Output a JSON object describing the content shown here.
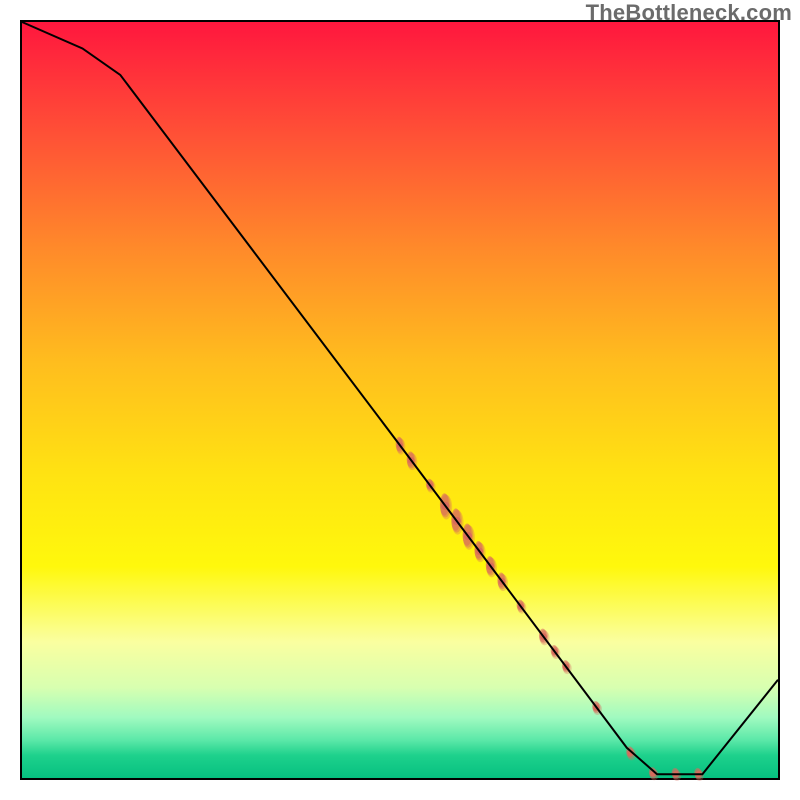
{
  "watermark": "TheBottleneck.com",
  "chart_data": {
    "type": "line",
    "title": "",
    "xlabel": "",
    "ylabel": "",
    "xlim": [
      0,
      100
    ],
    "ylim": [
      0,
      100
    ],
    "curve": {
      "x": [
        0,
        8,
        13,
        50,
        80,
        84,
        90,
        100
      ],
      "y": [
        100,
        96.5,
        93,
        44,
        4,
        0.5,
        0.5,
        13
      ]
    },
    "scatter_clusters": [
      {
        "cx": 50.0,
        "cy": 44.0,
        "r": 3.8,
        "cluster_height": 2.0
      },
      {
        "cx": 51.5,
        "cy": 42.0,
        "r": 4.2,
        "cluster_height": 2.0
      },
      {
        "cx": 54.0,
        "cy": 38.7,
        "r": 3.8,
        "cluster_height": 1.0
      },
      {
        "cx": 56.0,
        "cy": 36.0,
        "r": 5.0,
        "cluster_height": 3.5
      },
      {
        "cx": 57.5,
        "cy": 34.0,
        "r": 5.0,
        "cluster_height": 3.5
      },
      {
        "cx": 59.0,
        "cy": 32.0,
        "r": 5.0,
        "cluster_height": 3.5
      },
      {
        "cx": 60.5,
        "cy": 30.0,
        "r": 4.5,
        "cluster_height": 2.5
      },
      {
        "cx": 62.0,
        "cy": 28.0,
        "r": 4.5,
        "cluster_height": 2.5
      },
      {
        "cx": 63.5,
        "cy": 26.0,
        "r": 4.2,
        "cluster_height": 2.0
      },
      {
        "cx": 66.0,
        "cy": 22.7,
        "r": 3.8,
        "cluster_height": 1.0
      },
      {
        "cx": 69.0,
        "cy": 18.7,
        "r": 4.2,
        "cluster_height": 1.5
      },
      {
        "cx": 70.5,
        "cy": 16.7,
        "r": 3.8,
        "cluster_height": 1.0
      },
      {
        "cx": 72.0,
        "cy": 14.7,
        "r": 3.8,
        "cluster_height": 1.0
      },
      {
        "cx": 76.0,
        "cy": 9.3,
        "r": 3.8,
        "cluster_height": 1.0
      },
      {
        "cx": 80.5,
        "cy": 3.3,
        "r": 3.8,
        "cluster_height": 1.0
      },
      {
        "cx": 83.5,
        "cy": 0.6,
        "r": 3.8,
        "cluster_height": 0.8
      },
      {
        "cx": 86.5,
        "cy": 0.5,
        "r": 3.8,
        "cluster_height": 0.8
      },
      {
        "cx": 89.5,
        "cy": 0.5,
        "r": 3.8,
        "cluster_height": 0.8
      }
    ],
    "scatter_color": "#d86a5c",
    "curve_color": "#000000"
  }
}
